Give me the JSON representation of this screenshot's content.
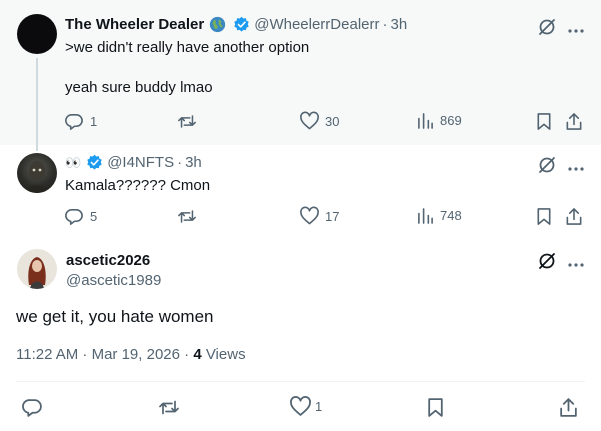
{
  "tweets": [
    {
      "name": "The Wheeler Dealer",
      "has_emoji": "globe-icon",
      "handle": "@WheelerrDealerr",
      "time": "3h",
      "text": ">we didn't really have another option\n\nyeah sure buddy lmao",
      "replies": "1",
      "retweets": "",
      "likes": "30",
      "views": "869"
    },
    {
      "name": "👀",
      "handle": "@I4NFTS",
      "time": "3h",
      "text": "Kamala?????? Cmon",
      "replies": "5",
      "retweets": "",
      "likes": "17",
      "views": "748"
    }
  ],
  "main": {
    "name": "ascetic2026",
    "handle": "@ascetic1989",
    "text": "we get it, you hate women",
    "timestamp": "11:22 AM · Mar 19, 2026 · ",
    "views_count": "4",
    "views_label": " Views",
    "likes": "1"
  },
  "colors": {
    "verified": "#1d9bf0",
    "muted": "#536471",
    "thread_line": "#cfd9de"
  }
}
